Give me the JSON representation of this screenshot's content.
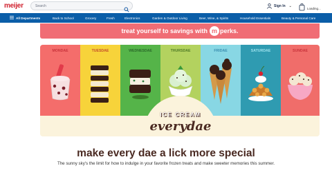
{
  "header": {
    "logo": "meijer",
    "search_placeholder": "Search",
    "signin_label": "Sign In",
    "cart_label": "Loading..."
  },
  "nav": {
    "all_departments": "All Departments",
    "items": [
      "Back to School",
      "Grocery",
      "Fresh",
      "Electronics",
      "Garden & Outdoor Living",
      "Beer, Wine, & Spirits",
      "Household Essentials",
      "Beauty & Personal Care"
    ]
  },
  "promo": {
    "text": "treat yourself to savings with",
    "brand_m": "m",
    "brand_word": "perks."
  },
  "days": [
    {
      "label": "MONDAE",
      "bg": "#f46d6b",
      "color": "#c8323a"
    },
    {
      "label": "TUESDAE",
      "bg": "#f7d33a",
      "color": "#c44c2a"
    },
    {
      "label": "WEDNESDAE",
      "bg": "#55b449",
      "color": "#2a6a2a"
    },
    {
      "label": "THURSDAE",
      "bg": "#b3d25f",
      "color": "#4f7a26"
    },
    {
      "label": "FRIDAE",
      "bg": "#88d7e4",
      "color": "#3b8fb0"
    },
    {
      "label": "SATURDAE",
      "bg": "#2f9bb1",
      "color": "#9fe3ee"
    },
    {
      "label": "SUNDAE",
      "bg": "#f06d6a",
      "color": "#c8323a"
    }
  ],
  "badge": {
    "top": "ICE CREAM",
    "script": "everydae"
  },
  "headline": "make every dae a lick more special",
  "subline": "The sunny sky's the limit for how to indulge in your favorite frozen treats and make sweeter memories this summer.",
  "colors": {
    "brand_red": "#d0212e",
    "nav_blue": "#0b5ea8",
    "promo_pink": "#f06d75",
    "cream": "#fbf3dc",
    "brown": "#4a2a22"
  }
}
